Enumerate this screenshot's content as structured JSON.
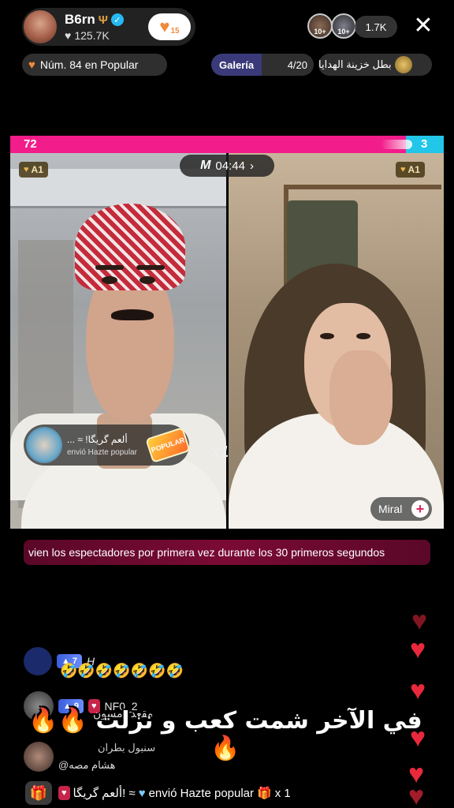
{
  "host": {
    "name": "B6rn",
    "trident": "Ψ",
    "likes": "125.7K",
    "follow_count": "15"
  },
  "viewers": {
    "avatar_badges": [
      "10+",
      "10+"
    ],
    "count": "1.7K"
  },
  "close_label": "✕",
  "rank": {
    "label": "Núm. 84 en Popular"
  },
  "gallery": {
    "label": "Galería",
    "count": "4/20"
  },
  "treasure": {
    "label": "بطل خزينة الهدايا"
  },
  "battle": {
    "score_left": "72",
    "score_right": "3",
    "timer": "04:44",
    "timer_logo": "M",
    "left_rank": "A1",
    "right_rank": "A1",
    "colors": {
      "left": "#f21c8a",
      "right": "#22c6e8"
    }
  },
  "gift_notice": {
    "sender": "ألعم گريگا! ≈ ...",
    "action": "envió Hazte popular",
    "badge": "POPULAR",
    "multiplier": "x1"
  },
  "guest": {
    "name": "Miral"
  },
  "info_banner": "vien los espectadores por primera vez durante los 30 primeros segundos",
  "chat": [
    {
      "level": "7",
      "user": "H",
      "message": "🤣🤣🤣🤣🤣🤣🤣"
    },
    {
      "level": "9",
      "fan_badge": "♥",
      "user": "NF0_2",
      "message": "مقعد دمسون"
    },
    {
      "user": "سنبول بطران",
      "message": "هشام مصه@"
    }
  ],
  "overlay_caption": "في الآخر شمت كعب و نزلت 🔥🔥🔥",
  "bottom_gift": {
    "sender": "ألعم گريگا! ≈",
    "action": "envió Hazte popular",
    "multiplier": "x 1"
  },
  "icons": {
    "gift": "gift-icon",
    "heart": "heart-icon",
    "verified": "verified-icon"
  }
}
